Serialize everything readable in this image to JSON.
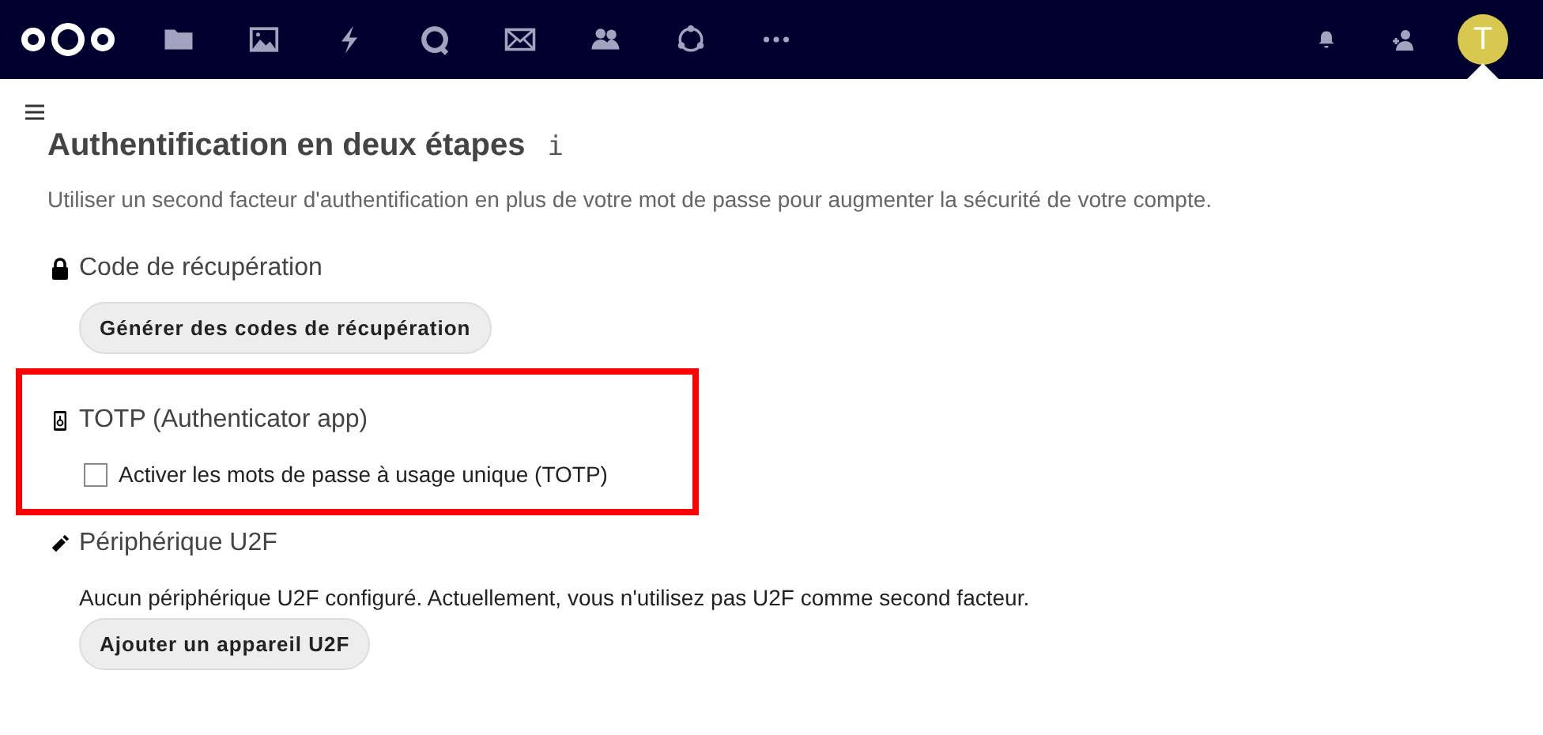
{
  "header": {
    "avatar": {
      "initial": "T",
      "color": "#d9c850"
    }
  },
  "page": {
    "title": "Authentification en deux étapes",
    "info": "i",
    "description": "Utiliser un second facteur d'authentification en plus de votre mot de passe pour augmenter la sécurité de votre compte."
  },
  "sections": [
    {
      "kind": "backup",
      "title": "Code de récupération",
      "highlighted": false,
      "button": "Générer des codes de récupération"
    },
    {
      "kind": "totp",
      "title": "TOTP (Authenticator app)",
      "highlighted": true,
      "checkbox": {
        "label": "Activer les mots de passe à usage unique (TOTP)",
        "checked": false
      }
    },
    {
      "kind": "u2f",
      "title": "Périphérique U2F",
      "highlighted": false,
      "text": "Aucun périphérique U2F configuré. Actuellement, vous n'utilisez pas U2F comme second facteur.",
      "button": "Ajouter un appareil U2F"
    }
  ]
}
